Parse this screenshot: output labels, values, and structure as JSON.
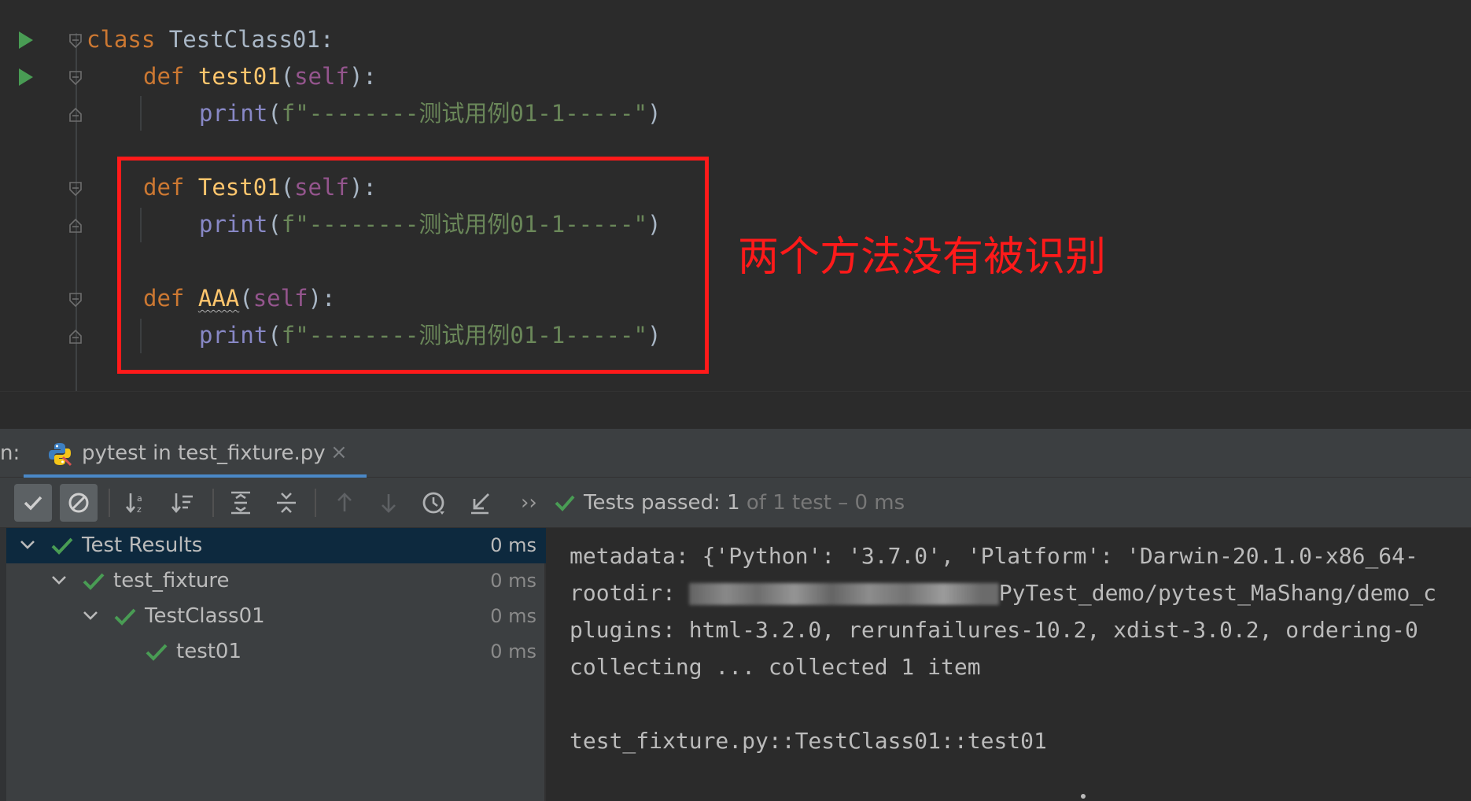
{
  "editor": {
    "class_line": {
      "kw": "class",
      "name": " TestClass01",
      "punc": ":"
    },
    "methods": [
      {
        "kw": "def",
        "name": "test01",
        "params": "self",
        "body_fn": "print",
        "body_str": "f\"--------测试用例01-1-----\""
      },
      {
        "kw": "def",
        "name": "Test01",
        "params": "self",
        "body_fn": "print",
        "body_str": "f\"--------测试用例01-1-----\""
      },
      {
        "kw": "def",
        "name": "AAA",
        "params": "self",
        "body_fn": "print",
        "body_str": "f\"--------测试用例01-1-----\""
      }
    ],
    "annotation": "两个方法没有被识别",
    "annotation_color": "#ff1a1a"
  },
  "run_panel": {
    "label": "n:",
    "tab_title": "pytest in test_fixture.py",
    "tab_close": "×",
    "toolbar": {
      "chevrons": "››",
      "status_prefix": "Tests passed: ",
      "status_count": "1",
      "status_suffix": " of 1 test – 0 ms"
    },
    "tree": [
      {
        "label": "Test Results",
        "time": "0 ms",
        "depth": 0,
        "expanded": true,
        "selected": true
      },
      {
        "label": "test_fixture",
        "time": "0 ms",
        "depth": 1,
        "expanded": true,
        "selected": false
      },
      {
        "label": "TestClass01",
        "time": "0 ms",
        "depth": 2,
        "expanded": true,
        "selected": false
      },
      {
        "label": "test01",
        "time": "0 ms",
        "depth": 3,
        "expanded": false,
        "selected": false
      }
    ],
    "console": {
      "metadata": "metadata: {'Python': '3.7.0', 'Platform': 'Darwin-20.1.0-x86_64-",
      "rootdir_prefix": "rootdir: ",
      "rootdir_suffix": "PyTest_demo/pytest_MaShang/demo_c",
      "plugins": "plugins: html-3.2.0, rerunfailures-10.2, xdist-3.0.2, ordering-0",
      "collecting": "collecting ... collected 1 item",
      "test_id": "test_fixture.py::TestClass01::test01"
    }
  },
  "colors": {
    "pass_green": "#499c54",
    "editor_bg": "#2b2b2b",
    "panel_bg": "#3c3f41",
    "selection": "#0d293e",
    "accent": "#4a88c7"
  }
}
